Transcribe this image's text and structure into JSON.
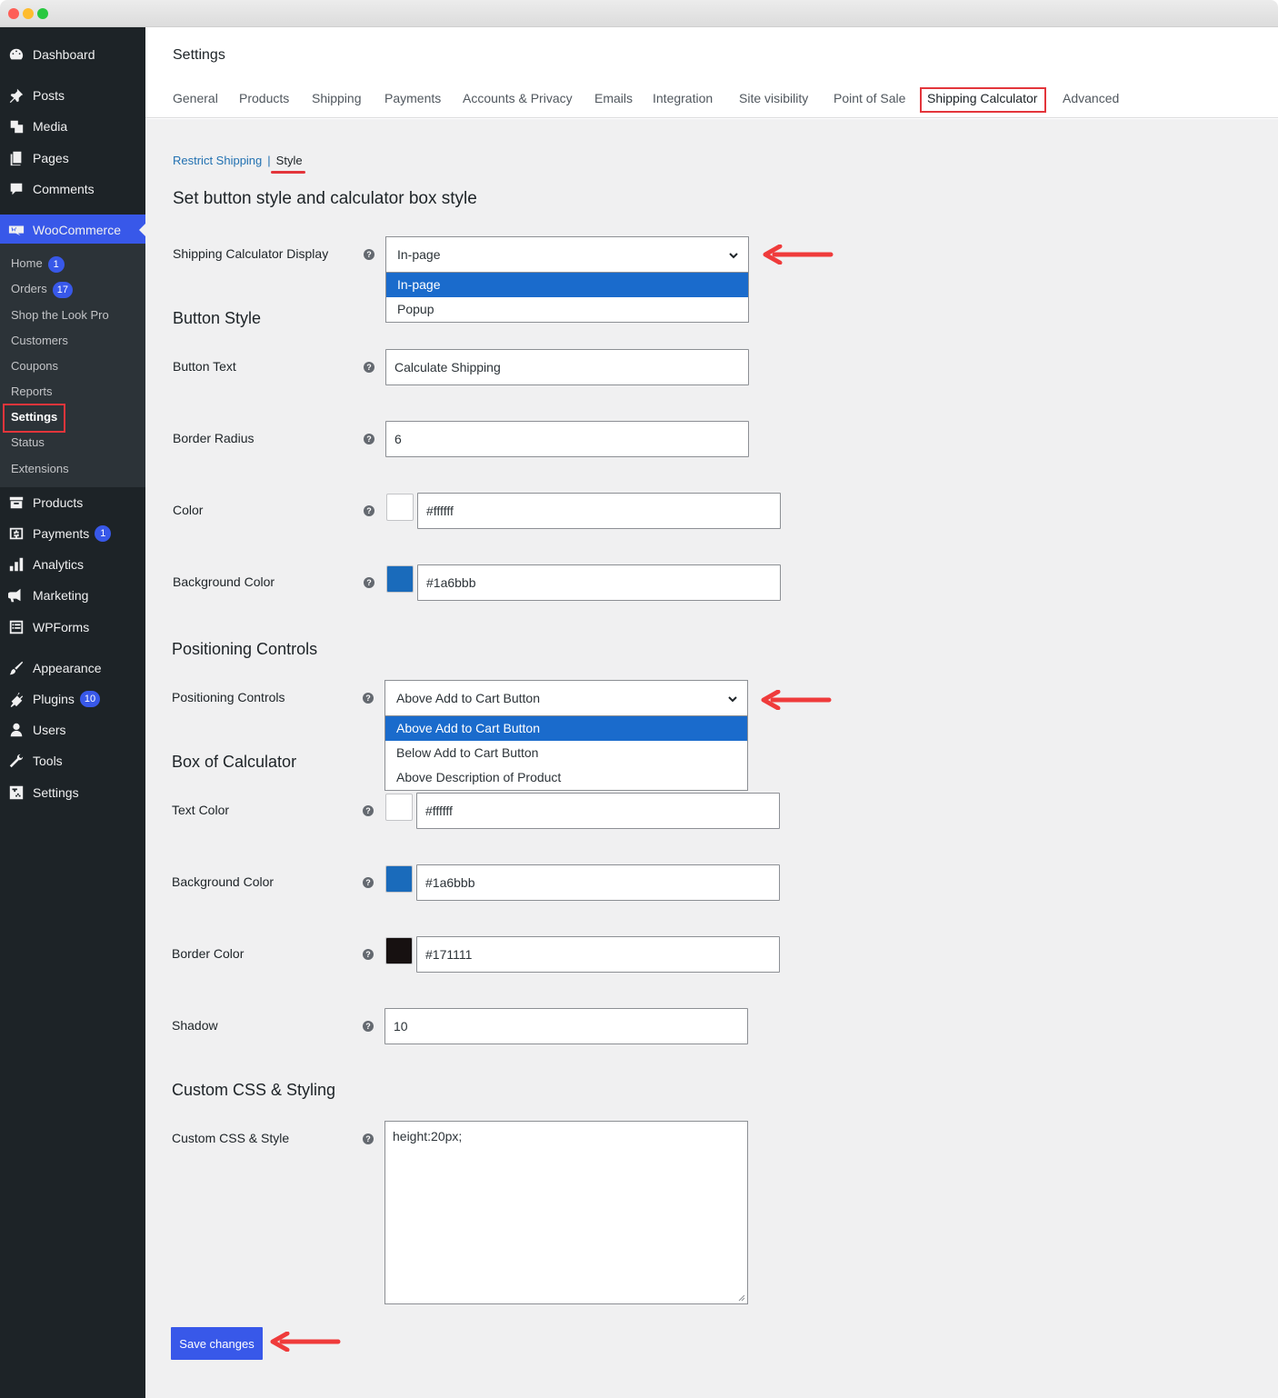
{
  "sidebar": {
    "items": [
      {
        "label": "Dashboard",
        "icon": "dashboard-icon"
      },
      {
        "label": "Posts",
        "icon": "pin-icon"
      },
      {
        "label": "Media",
        "icon": "media-icon"
      },
      {
        "label": "Pages",
        "icon": "pages-icon"
      },
      {
        "label": "Comments",
        "icon": "comment-icon"
      },
      {
        "label": "WooCommerce",
        "icon": "woocommerce-icon"
      },
      {
        "label": "Products",
        "icon": "archive-icon"
      },
      {
        "label": "Payments",
        "icon": "money-icon",
        "badge": "1"
      },
      {
        "label": "Analytics",
        "icon": "bar-chart-icon"
      },
      {
        "label": "Marketing",
        "icon": "megaphone-icon"
      },
      {
        "label": "WPForms",
        "icon": "form-icon"
      },
      {
        "label": "Appearance",
        "icon": "brush-icon"
      },
      {
        "label": "Plugins",
        "icon": "plugin-icon",
        "badge": "10"
      },
      {
        "label": "Users",
        "icon": "user-icon"
      },
      {
        "label": "Tools",
        "icon": "wrench-icon"
      },
      {
        "label": "Settings",
        "icon": "settings-icon"
      }
    ],
    "woo_submenu": [
      {
        "label": "Home",
        "badge": "1"
      },
      {
        "label": "Orders",
        "badge": "17"
      },
      {
        "label": "Shop the Look Pro"
      },
      {
        "label": "Customers"
      },
      {
        "label": "Coupons"
      },
      {
        "label": "Reports"
      },
      {
        "label": "Settings"
      },
      {
        "label": "Status"
      },
      {
        "label": "Extensions"
      }
    ]
  },
  "header": {
    "title": "Settings",
    "tabs": [
      "General",
      "Products",
      "Shipping",
      "Payments",
      "Accounts & Privacy",
      "Emails",
      "Integration",
      "Site visibility",
      "Point of Sale",
      "Shipping Calculator",
      "Advanced"
    ],
    "active_tab": "Shipping Calculator"
  },
  "subnav": {
    "restrict": "Restrict Shipping",
    "separator": "|",
    "style": "Style"
  },
  "sections": {
    "main_title": "Set button style and calculator box style",
    "button_style": "Button Style",
    "positioning": "Positioning Controls",
    "box": "Box of Calculator",
    "custom_css": "Custom CSS & Styling"
  },
  "fields": {
    "display": {
      "label": "Shipping Calculator Display",
      "value": "In-page",
      "options": [
        "In-page",
        "Popup"
      ]
    },
    "button_text": {
      "label": "Button Text",
      "value": "Calculate Shipping"
    },
    "border_radius": {
      "label": "Border Radius",
      "value": "6"
    },
    "color": {
      "label": "Color",
      "value": "#ffffff"
    },
    "bg_color": {
      "label": "Background Color",
      "value": "#1a6bbb"
    },
    "positioning": {
      "label": "Positioning Controls",
      "value": "Above Add to Cart Button",
      "options": [
        "Above Add to Cart Button",
        "Below Add to Cart Button",
        "Above Description of Product"
      ]
    },
    "text_color": {
      "label": "Text Color",
      "value": "#ffffff"
    },
    "box_bg_color": {
      "label": "Background Color",
      "value": "#1a6bbb"
    },
    "border_color": {
      "label": "Border Color",
      "value": "#171111"
    },
    "shadow": {
      "label": "Shadow",
      "value": "10"
    },
    "custom_css": {
      "label": "Custom CSS & Style",
      "value": "height:20px;"
    }
  },
  "save_label": "Save changes",
  "help_glyph": "?",
  "colors": {
    "accent": "#3858e9",
    "highlight": "#e3353b",
    "dropdown_selected": "#1a6bcc"
  }
}
